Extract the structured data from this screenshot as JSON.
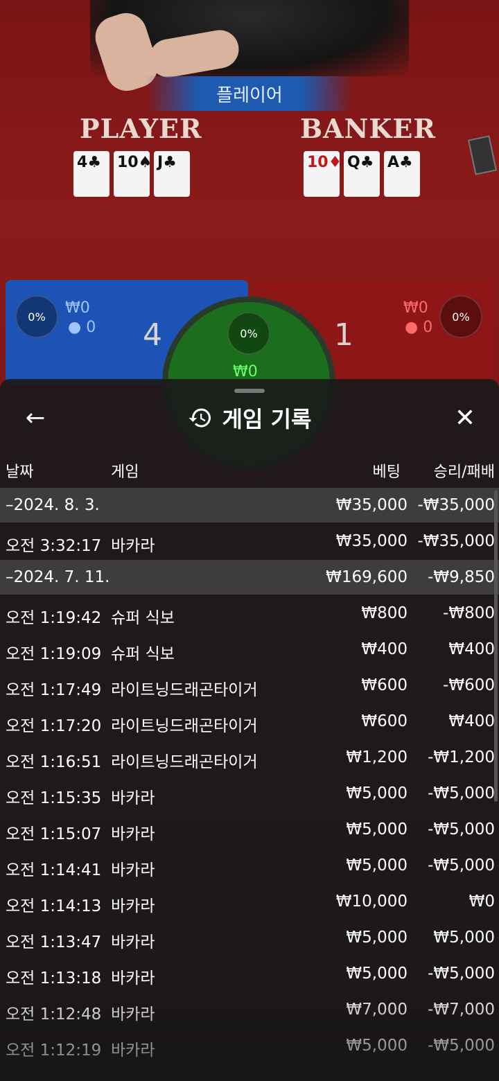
{
  "table": {
    "winner_banner": "플레이어",
    "player_label": "PLAYER",
    "banker_label": "BANKER",
    "player_cards": [
      {
        "rank": "4",
        "suit": "♣",
        "color": "black"
      },
      {
        "rank": "10",
        "suit": "♠",
        "color": "black"
      },
      {
        "rank": "J",
        "suit": "♣",
        "color": "black"
      }
    ],
    "banker_cards": [
      {
        "rank": "10",
        "suit": "♦",
        "color": "red"
      },
      {
        "rank": "Q",
        "suit": "♣",
        "color": "black"
      },
      {
        "rank": "A",
        "suit": "♣",
        "color": "black"
      }
    ],
    "player_pct": "0%",
    "player_amount": "₩0",
    "player_count": "0",
    "player_score": "4",
    "tie_pct": "0%",
    "tie_amount": "₩0",
    "banker_pct": "0%",
    "banker_amount": "₩0",
    "banker_count": "0",
    "banker_score": "1"
  },
  "sheet": {
    "title": "게임 기록",
    "back_icon": "arrow-left-icon",
    "close_icon": "close-icon",
    "title_icon": "history-icon",
    "columns": {
      "date": "날짜",
      "game": "게임",
      "bet": "베팅",
      "result": "승리/패배"
    },
    "rows": [
      {
        "type": "date",
        "date": "–2024. 8. 3.",
        "game": "",
        "bet": "₩35,000",
        "result": "-₩35,000"
      },
      {
        "type": "item",
        "date": "오전 3:32:17",
        "game": "바카라",
        "bet": "₩35,000",
        "result": "-₩35,000"
      },
      {
        "type": "date",
        "date": "–2024. 7. 11.",
        "game": "",
        "bet": "₩169,600",
        "result": "-₩9,850"
      },
      {
        "type": "item",
        "date": "오전 1:19:42",
        "game": "슈퍼 식보",
        "bet": "₩800",
        "result": "-₩800"
      },
      {
        "type": "item",
        "date": "오전 1:19:09",
        "game": "슈퍼 식보",
        "bet": "₩400",
        "result": "₩400"
      },
      {
        "type": "item",
        "date": "오전 1:17:49",
        "game": "라이트닝드래곤타이거",
        "bet": "₩600",
        "result": "-₩600"
      },
      {
        "type": "item",
        "date": "오전 1:17:20",
        "game": "라이트닝드래곤타이거",
        "bet": "₩600",
        "result": "₩400"
      },
      {
        "type": "item",
        "date": "오전 1:16:51",
        "game": "라이트닝드래곤타이거",
        "bet": "₩1,200",
        "result": "-₩1,200"
      },
      {
        "type": "item",
        "date": "오전 1:15:35",
        "game": "바카라",
        "bet": "₩5,000",
        "result": "-₩5,000"
      },
      {
        "type": "item",
        "date": "오전 1:15:07",
        "game": "바카라",
        "bet": "₩5,000",
        "result": "-₩5,000"
      },
      {
        "type": "item",
        "date": "오전 1:14:41",
        "game": "바카라",
        "bet": "₩5,000",
        "result": "-₩5,000"
      },
      {
        "type": "item",
        "date": "오전 1:14:13",
        "game": "바카라",
        "bet": "₩10,000",
        "result": "₩0"
      },
      {
        "type": "item",
        "date": "오전 1:13:47",
        "game": "바카라",
        "bet": "₩5,000",
        "result": "₩5,000"
      },
      {
        "type": "item",
        "date": "오전 1:13:18",
        "game": "바카라",
        "bet": "₩5,000",
        "result": "-₩5,000"
      },
      {
        "type": "item",
        "date": "오전 1:12:48",
        "game": "바카라",
        "bet": "₩7,000",
        "result": "-₩7,000"
      },
      {
        "type": "item",
        "date": "오전 1:12:19",
        "game": "바카라",
        "bet": "₩5,000",
        "result": "-₩5,000"
      }
    ]
  },
  "colors": {
    "table_red": "#8c1b1b",
    "player_blue": "#1c53b5",
    "tie_green": "#1b6e1b",
    "sheet_bg": "#1a1a1a",
    "date_row_bg": "#5a5a5a"
  }
}
